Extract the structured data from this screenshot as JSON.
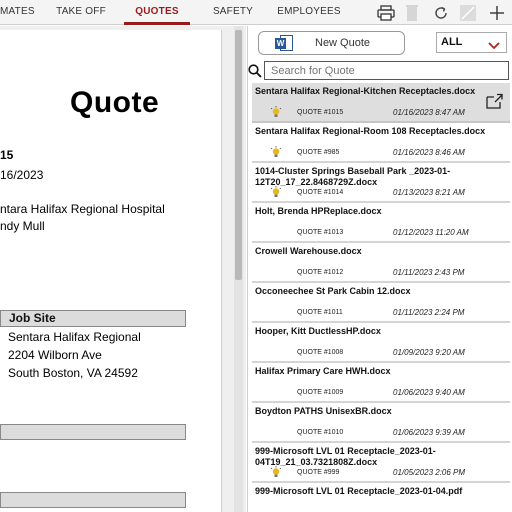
{
  "tabs": [
    {
      "label": "MATES"
    },
    {
      "label": "TAKE OFF"
    },
    {
      "label": "QUOTES"
    },
    {
      "label": "SAFETY"
    },
    {
      "label": "EMPLOYEES"
    }
  ],
  "toolbar_icons": [
    "printer-icon",
    "trash-icon",
    "refresh-icon",
    "edit-icon",
    "plus-icon"
  ],
  "document": {
    "title": "Quote",
    "lines": [
      "15",
      "16/2023",
      "ntara Halifax Regional Hospital",
      "ndy Mull"
    ],
    "job_site_header": "Job Site",
    "job_site_lines": [
      "Sentara Halifax Regional",
      "2204 Wilborn Ave",
      "South Boston, VA 24592"
    ]
  },
  "panel": {
    "new_quote_label": "New Quote",
    "word_badge": "W",
    "filter_value": "ALL",
    "search_placeholder": "Search for Quote"
  },
  "quotes": [
    {
      "name": "Sentara Halifax Regional-Kitchen Receptacles.docx",
      "number": "QUOTE #1015",
      "date": "01/16/2023 8:47 AM",
      "bulb": true
    },
    {
      "name": "Sentara Halifax Regional-Room 108 Receptacles.docx",
      "number": "QUOTE #985",
      "date": "01/16/2023 8:46 AM",
      "bulb": true
    },
    {
      "name": "1014-Cluster Springs Baseball Park _2023-01-12T20_17_22.8468729Z.docx",
      "number": "QUOTE #1014",
      "date": "01/13/2023 8:21 AM",
      "bulb": true
    },
    {
      "name": "Holt, Brenda HPReplace.docx",
      "number": "QUOTE #1013",
      "date": "01/12/2023 11:20 AM",
      "bulb": false
    },
    {
      "name": "Crowell Warehouse.docx",
      "number": "QUOTE #1012",
      "date": "01/11/2023 2:43 PM",
      "bulb": false
    },
    {
      "name": "Occoneechee St Park Cabin 12.docx",
      "number": "QUOTE #1011",
      "date": "01/11/2023 2:24 PM",
      "bulb": false
    },
    {
      "name": "Hooper, Kitt DuctlessHP.docx",
      "number": "QUOTE #1008",
      "date": "01/09/2023 9:20 AM",
      "bulb": false
    },
    {
      "name": "Halifax Primary Care HWH.docx",
      "number": "QUOTE #1009",
      "date": "01/06/2023 9:40 AM",
      "bulb": false
    },
    {
      "name": "Boydton PATHS UnisexBR.docx",
      "number": "QUOTE #1010",
      "date": "01/06/2023 9:39 AM",
      "bulb": false
    },
    {
      "name": "999-Microsoft LVL 01 Receptacle_2023-01-04T19_21_03.7321808Z.docx",
      "number": "QUOTE #999",
      "date": "01/05/2023 2:06 PM",
      "bulb": true
    },
    {
      "name": "999-Microsoft LVL 01 Receptacle_2023-01-04.pdf",
      "number": "",
      "date": "",
      "bulb": false
    }
  ],
  "colors": {
    "accent": "#9a1b1b",
    "bulb": "#e8b81a",
    "word": "#2b5797"
  }
}
